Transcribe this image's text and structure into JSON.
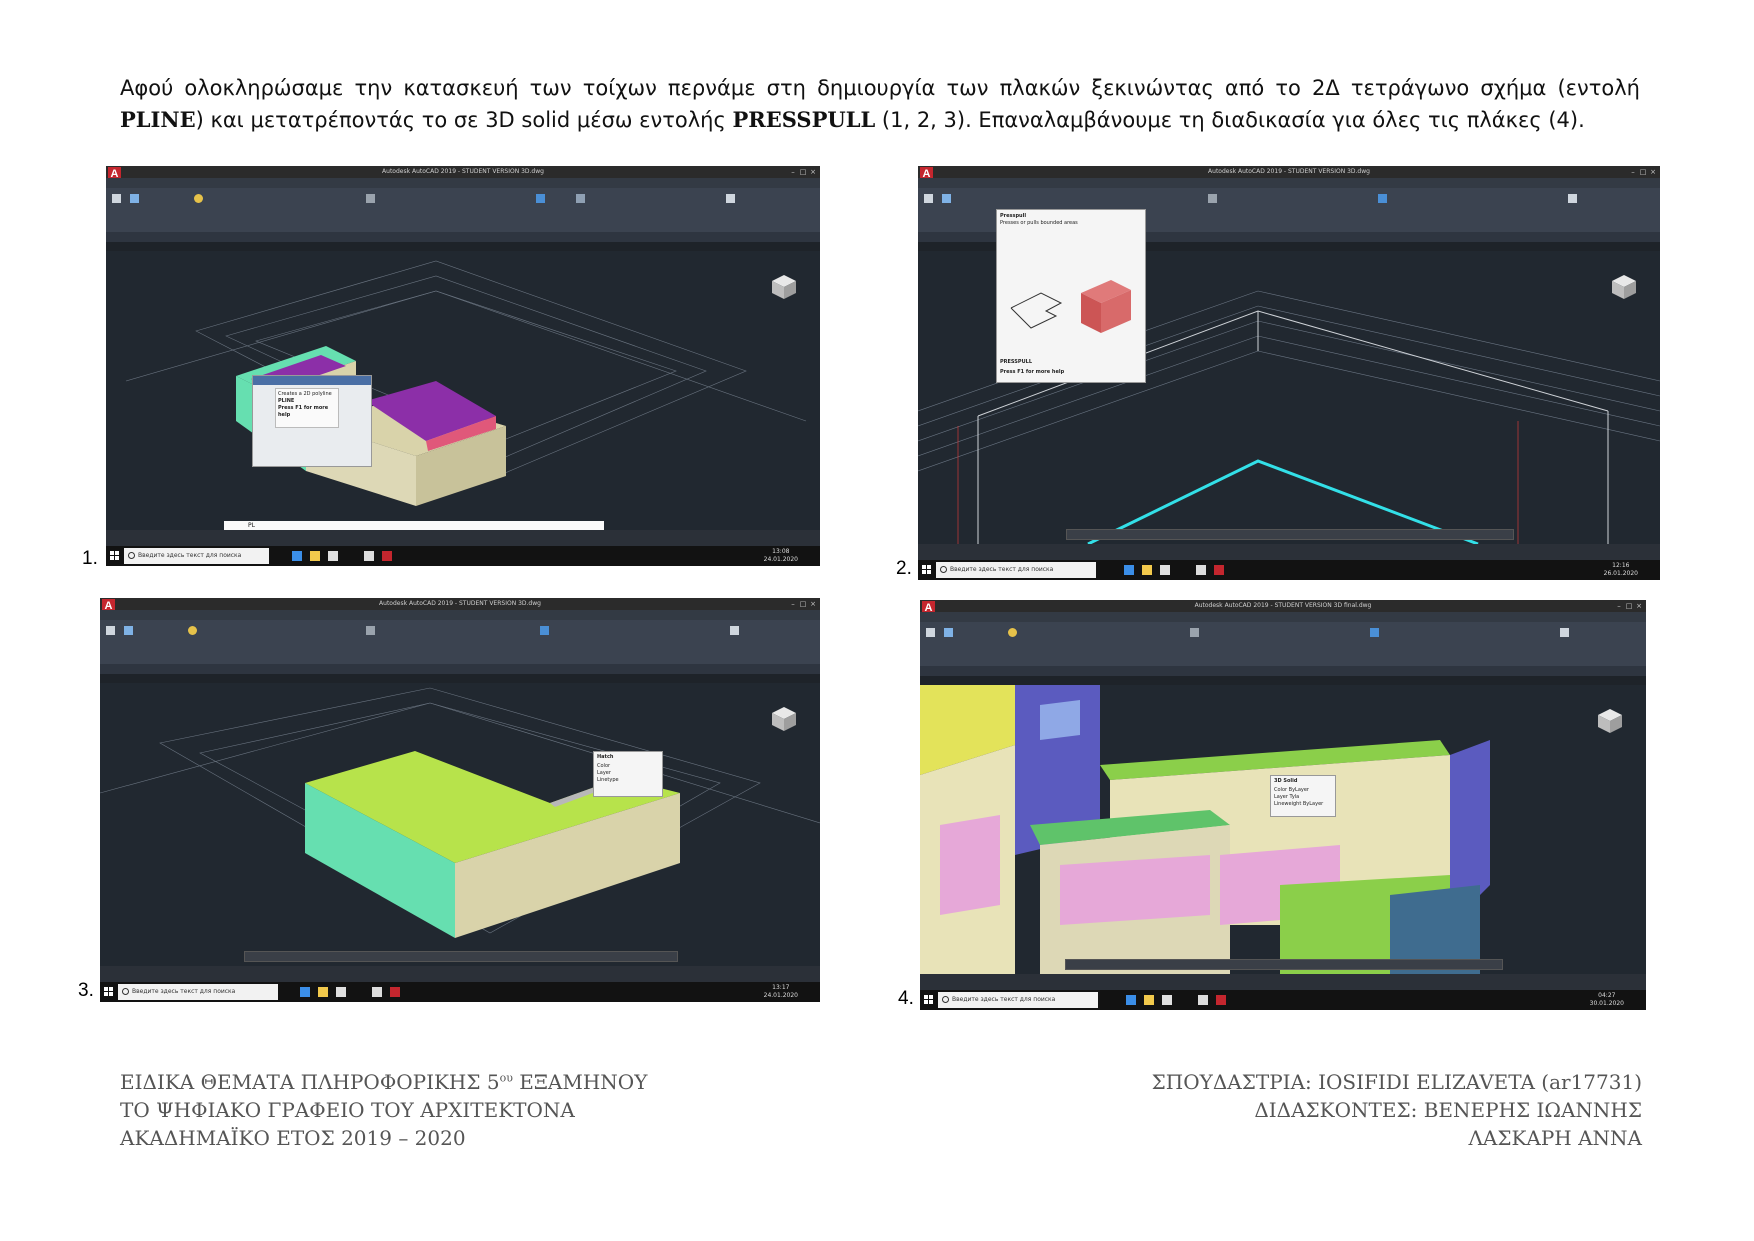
{
  "intro": {
    "part1": "Αφού ολοκληρώσαμε την κατασκευή των τοίχων περνάμε στη δημιουργία των πλακών ξεκινώντας από το 2Δ τετράγωνο σχήμα (εντολή ",
    "cmd1": "PLINE",
    "part2": ") και μετατρέποντάς το σε 3D solid μέσω εντολής ",
    "cmd2": "PRESSPULL",
    "part3": " (1, 2, 3). Επαναλαμβάνουμε τη διαδικασία για όλες τις πλάκες (4)."
  },
  "screens": [
    {
      "number": "1.",
      "title": "Autodesk AutoCAD 2019 - STUDENT VERSION   3D.dwg",
      "search_placeholder": "Введите здесь текст для поиска",
      "time": "13:08",
      "date": "24.01.2020",
      "tooltip_title": "PLINE",
      "tooltip_desc": "Creates a 2D polyline",
      "tooltip_help": "Press F1 for more help",
      "command": "PL"
    },
    {
      "number": "2.",
      "title": "Autodesk AutoCAD 2019 - STUDENT VERSION   3D.dwg",
      "search_placeholder": "Введите здесь текст для поиска",
      "time": "12:16",
      "date": "26.01.2020",
      "tooltip_title": "Presspull",
      "tooltip_desc": "Presses or pulls bounded areas",
      "tooltip_cmd": "PRESSPULL",
      "tooltip_help": "Press F1 for more help"
    },
    {
      "number": "3.",
      "title": "Autodesk AutoCAD 2019 - STUDENT VERSION   3D.dwg",
      "search_placeholder": "Введите здесь текст для поиска",
      "time": "13:17",
      "date": "24.01.2020",
      "tooltip_title": "Hatch",
      "tooltip_rows": [
        "Color",
        "Layer",
        "Linetype"
      ]
    },
    {
      "number": "4.",
      "title": "Autodesk AutoCAD 2019 - STUDENT VERSION   3D final.dwg",
      "search_placeholder": "Введите здесь текст для поиска",
      "time": "04:27",
      "date": "30.01.2020",
      "tooltip_title": "3D Solid",
      "tooltip_rows": [
        "Color",
        "Layer",
        "Lineweight"
      ],
      "tooltip_vals": [
        "ByLayer",
        "Tyla",
        "ByLayer"
      ]
    }
  ],
  "footer": {
    "left_line1_a": "ΕΙΔΙΚΑ ΘΕΜΑΤΑ ΠΛΗΡΟΦΟΡΙΚΗΣ 5",
    "left_line1_sup": "ου",
    "left_line1_b": " ΕΞΑΜΗΝΟΥ",
    "left_line2": "ΤΟ ΨΗΦΙΑΚΟ ΓΡΑΦΕΙΟ ΤΟΥ ΑΡΧΙΤΕΚΤΟΝΑ",
    "left_line3": "ΑΚΑΔΗΜΑΪΚΟ ΕΤΟΣ 2019 – 2020",
    "right_line1": "ΣΠΟΥΔΑΣΤΡΙΑ: IOSIFIDI ELIZAVETA (ar17731)",
    "right_line2": "ΔΙΔΑΣΚΟΝΤΕΣ: ΒΕΝΕΡΗΣ ΙΩΑΝΝΗΣ",
    "right_line3": "ΛΑΣΚΑΡΗ ΑΝΝΑ"
  },
  "colors": {
    "viewport_bg": "#212830",
    "ribbon_bg": "#3b4350",
    "wall_mint": "#66dfb0",
    "wall_beige": "#d9d3aa",
    "slab_lime": "#b7e34b",
    "room_purple": "#8c2fa8",
    "room_pink": "#e0587a",
    "facade_blue": "#5b5bbf",
    "cyan_edge": "#33e0e8"
  },
  "icons": [
    "autocad-logo-icon",
    "windows-start-icon",
    "search-icon",
    "viewcube-icon",
    "edge-icon",
    "explorer-icon",
    "store-icon",
    "mail-icon",
    "autocad-taskbar-icon"
  ]
}
